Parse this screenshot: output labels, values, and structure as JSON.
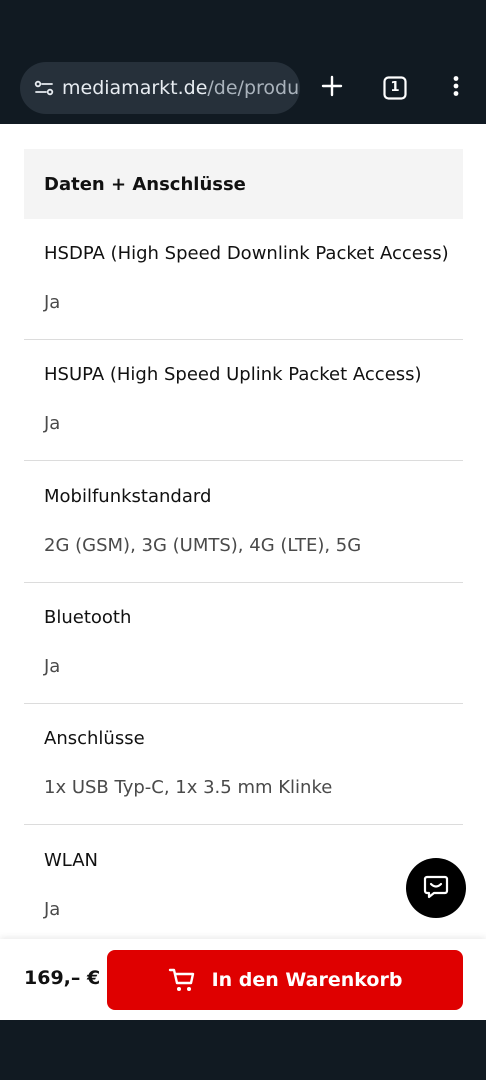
{
  "browser": {
    "url_host": "mediamarkt.de",
    "url_path": "/de/produc",
    "tab_count": "1"
  },
  "section": {
    "title": "Daten + Anschlüsse"
  },
  "specs": [
    {
      "label": "HSDPA (High Speed Downlink Packet Access)",
      "value": "Ja"
    },
    {
      "label": "HSUPA (High Speed Uplink Packet Access)",
      "value": "Ja"
    },
    {
      "label": "Mobilfunkstandard",
      "value": "2G (GSM), 3G (UMTS), 4G (LTE), 5G"
    },
    {
      "label": "Bluetooth",
      "value": "Ja"
    },
    {
      "label": "Anschlüsse",
      "value": "1x USB Typ-C, 1x 3.5 mm Klinke"
    },
    {
      "label": "WLAN",
      "value": "Ja"
    }
  ],
  "purchase": {
    "price": "169,– €",
    "cart_label": "In den Warenkorb"
  },
  "colors": {
    "accent": "#df0000",
    "browser_bg": "#111a22"
  },
  "icons": {
    "site_settings": "site-settings-icon",
    "new_tab": "plus-icon",
    "tabs": "tab-switcher-icon",
    "menu": "more-vert-icon",
    "chat": "chat-icon",
    "cart": "cart-icon"
  }
}
